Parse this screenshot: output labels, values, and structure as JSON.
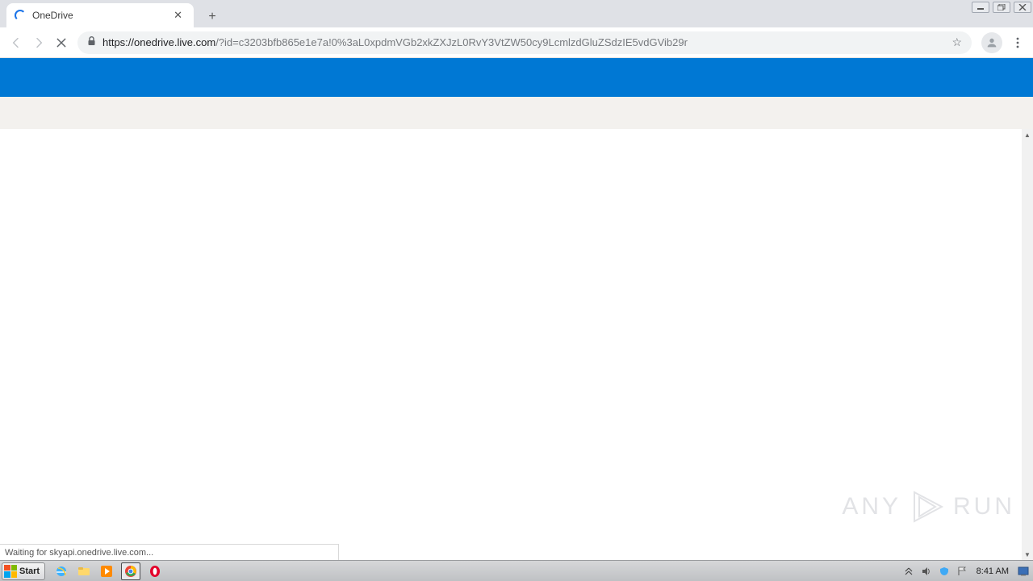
{
  "window": {
    "controls": {
      "minimize": "minimize",
      "maximize": "restore",
      "close": "close"
    }
  },
  "browser": {
    "tab": {
      "title": "OneDrive",
      "loading": true
    },
    "newtab_tooltip": "New tab",
    "nav": {
      "back": "Back",
      "forward": "Forward",
      "stop": "Stop"
    },
    "omnibox": {
      "scheme": "https://",
      "host": "onedrive.live.com",
      "path": "/?id=c3203bfb865e1e7a!0%3aL0xpdmVGb2xkZXJzL0RvY3VtZW50cy9LcmlzdGluZSdzIE5vdGVib29r"
    },
    "actions": {
      "bookmark": "Bookmark this page",
      "profile": "Profile",
      "menu": "Customize and control"
    },
    "status_text": "Waiting for skyapi.onedrive.live.com..."
  },
  "page": {
    "header_color": "#0078d4"
  },
  "taskbar": {
    "start_label": "Start",
    "icons": {
      "ie": "internet-explorer",
      "explorer": "file-explorer",
      "media": "media-player",
      "chrome": "chrome",
      "opera": "opera"
    },
    "tray": {
      "chevron": "show-hidden-icons",
      "volume": "volume",
      "shield": "security",
      "flag": "action-center",
      "clock": "8:41 AM",
      "desktop": "show-desktop"
    }
  },
  "watermark": {
    "left": "ANY",
    "right": "RUN"
  }
}
